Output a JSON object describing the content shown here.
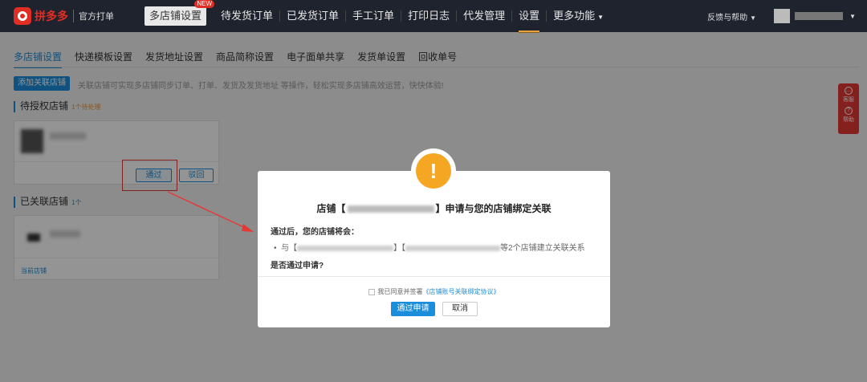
{
  "header": {
    "logo_text": "拼多多",
    "logo_sub": "官方打单",
    "nav": [
      {
        "label": "多店铺设置",
        "badge": "NEW"
      },
      {
        "label": "待发货订单"
      },
      {
        "label": "已发货订单"
      },
      {
        "label": "手工订单"
      },
      {
        "label": "打印日志"
      },
      {
        "label": "代发管理"
      },
      {
        "label": "设置"
      },
      {
        "label": "更多功能"
      }
    ],
    "feedback": "反馈与帮助"
  },
  "tabs": [
    "多店铺设置",
    "快递模板设置",
    "发货地址设置",
    "商品简称设置",
    "电子面单共享",
    "发货单设置",
    "回收单号"
  ],
  "toolbar": {
    "add_label": "添加关联店铺",
    "hint": "关联店铺可实现多店铺同步订单、打单、发货及发货地址 等操作，轻松实现多店铺高效运营，快快体验!"
  },
  "pending": {
    "title": "待授权店铺",
    "count": "1个待处理",
    "approve_label": "通过",
    "reject_label": "驳回"
  },
  "linked": {
    "title": "已关联店铺",
    "count": "1个",
    "current_label": "当前店铺"
  },
  "side_widget": {
    "service": "客服",
    "help": "帮助"
  },
  "modal": {
    "title_prefix": "店铺【",
    "title_suffix": "】申请与您的店铺绑定关联",
    "subtitle": "通过后，您的店铺将会：",
    "bullet_prefix": "与【",
    "bullet_mid": "】【",
    "bullet_suffix": "等2个店铺建立关联关系",
    "question": "是否通过申请?",
    "agree_text": "我已同意并签署",
    "agree_link": "《店铺账号关联绑定协议》",
    "ok_label": "通过申请",
    "cancel_label": "取消"
  },
  "colors": {
    "accent": "#1b8edb",
    "brand": "#e02e24",
    "warning": "#f5a623"
  }
}
